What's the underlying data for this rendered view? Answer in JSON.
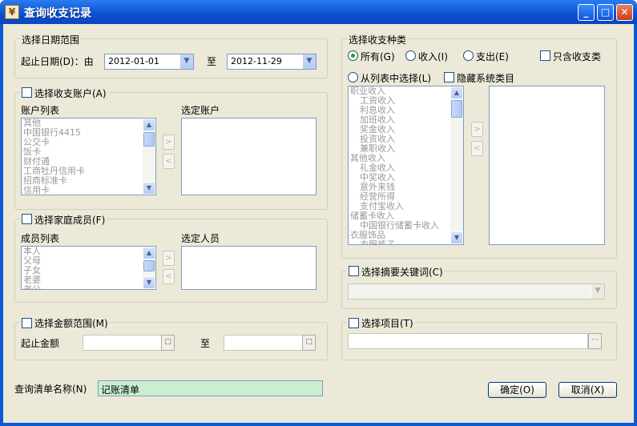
{
  "window": {
    "title": "查询收支记录",
    "icon": "¥"
  },
  "date_range": {
    "group_label": "选择日期范围",
    "label": "起止日期(D)：由",
    "from": "2012-01-01",
    "to_label": "至",
    "to": "2012-11-29"
  },
  "accounts": {
    "group_label": "选择收支账户(A)",
    "list_label": "账户列表",
    "selected_label": "选定账户",
    "items": [
      "其他",
      "中国银行4415",
      "公交卡",
      "饭卡",
      "财付通",
      "工商牡丹信用卡",
      "招商标准卡",
      "信用卡"
    ]
  },
  "members": {
    "group_label": "选择家庭成员(F)",
    "list_label": "成员列表",
    "selected_label": "选定人员",
    "items": [
      "本人",
      "父母",
      "子女",
      "老婆",
      "老公"
    ]
  },
  "amount": {
    "group_label": "选择金额范围(M)",
    "label": "起止金额",
    "to_label": "至"
  },
  "query_name": {
    "label": "查询清单名称(N)",
    "value": "记账清单"
  },
  "category": {
    "group_label": "选择收支种类",
    "all": "所有(G)",
    "income": "收入(I)",
    "expense": "支出(E)",
    "only_txn": "只含收支类",
    "from_list": "从列表中选择(L)",
    "hide_system": "隐藏系统类目",
    "items": [
      {
        "t": "职业收入",
        "i": 0
      },
      {
        "t": "工资收入",
        "i": 1
      },
      {
        "t": "利息收入",
        "i": 1
      },
      {
        "t": "加班收入",
        "i": 1
      },
      {
        "t": "奖金收入",
        "i": 1
      },
      {
        "t": "投资收入",
        "i": 1
      },
      {
        "t": "兼职收入",
        "i": 1
      },
      {
        "t": "其他收入",
        "i": 0
      },
      {
        "t": "礼金收入",
        "i": 1
      },
      {
        "t": "中奖收入",
        "i": 1
      },
      {
        "t": "意外来钱",
        "i": 1
      },
      {
        "t": "经营所得",
        "i": 1
      },
      {
        "t": "支付宝收入",
        "i": 1
      },
      {
        "t": "储蓄卡收入",
        "i": 0
      },
      {
        "t": "中国银行储蓄卡收入",
        "i": 1
      },
      {
        "t": "衣服饰品",
        "i": 0
      },
      {
        "t": "衣服裤子",
        "i": 1
      }
    ]
  },
  "keyword": {
    "group_label": "选择摘要关键词(C)"
  },
  "project": {
    "group_label": "选择项目(T)"
  },
  "buttons": {
    "ok": "确定(O)",
    "cancel": "取消(X)"
  }
}
